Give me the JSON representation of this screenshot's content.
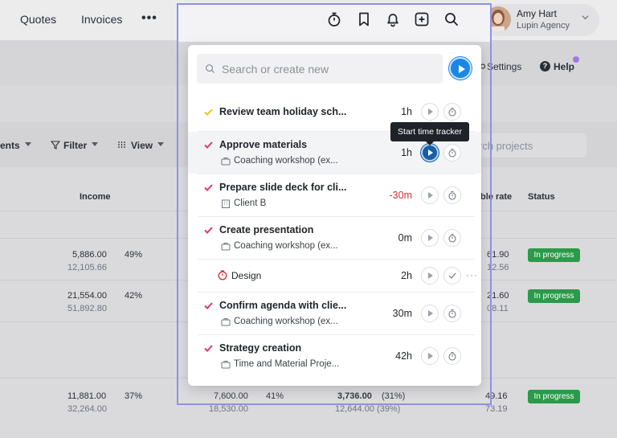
{
  "nav": {
    "quotes": "Quotes",
    "invoices": "Invoices",
    "more": "•••"
  },
  "user": {
    "name": "Amy Hart",
    "org": "Lupin Agency"
  },
  "subbar": {
    "settings": "Settings",
    "help": "Help",
    "help_glyph": "?"
  },
  "filters": {
    "clients_partial": "ents",
    "filter": "Filter",
    "view": "View",
    "search_partial": "rch projects"
  },
  "table": {
    "headers": {
      "income": "Income",
      "billable_partial": "ble rate",
      "status": "Status"
    },
    "rows": [
      {
        "income": "5,886.00",
        "income2": "12,105.66",
        "pct": "49%",
        "rate": "61.90",
        "rate2": "12.56",
        "status": "In progress"
      },
      {
        "income": "21,554.00",
        "income2": "51,892.80",
        "pct": "42%",
        "rate": "21.60",
        "rate2": "08.11",
        "status": "In progress"
      },
      {
        "income": "11,881.00",
        "income2": "32,264.00",
        "pct": "37%",
        "col2": "7,600.00",
        "col2b": "18,530.00",
        "col2pct": "41%",
        "col3": "3,736.00",
        "col3pct": "(31%)",
        "col3b": "12,644.00 (39%)",
        "rate": "49.16",
        "rate2": "73.19",
        "status": "In progress"
      }
    ]
  },
  "tracker": {
    "search_placeholder": "Search or create new",
    "tooltip": "Start time tracker",
    "items": [
      {
        "title": "Review team holiday sch...",
        "duration": "1h",
        "check_color": "#f2c31b"
      },
      {
        "title": "Approve materials",
        "sub": "Coaching workshop (ex...",
        "duration": "1h",
        "check_color": "#e0386a"
      },
      {
        "title": "Prepare slide deck for cli...",
        "sub": "Client B",
        "duration": "-30m",
        "check_color": "#e0386a"
      },
      {
        "title": "Create presentation",
        "sub": "Coaching workshop (ex...",
        "duration": "0m",
        "check_color": "#e0386a"
      },
      {
        "title": "Design",
        "duration": "2h",
        "more": "···"
      },
      {
        "title": "Confirm agenda with clie...",
        "sub": "Coaching workshop (ex...",
        "duration": "30m",
        "check_color": "#e0386a"
      },
      {
        "title": "Strategy creation",
        "sub": "Time and Material Proje...",
        "duration": "42h",
        "check_color": "#e0386a"
      }
    ]
  },
  "colors": {
    "accent": "#1b87e5",
    "negative": "#d62f2f",
    "badge": "#2b9a4a"
  }
}
